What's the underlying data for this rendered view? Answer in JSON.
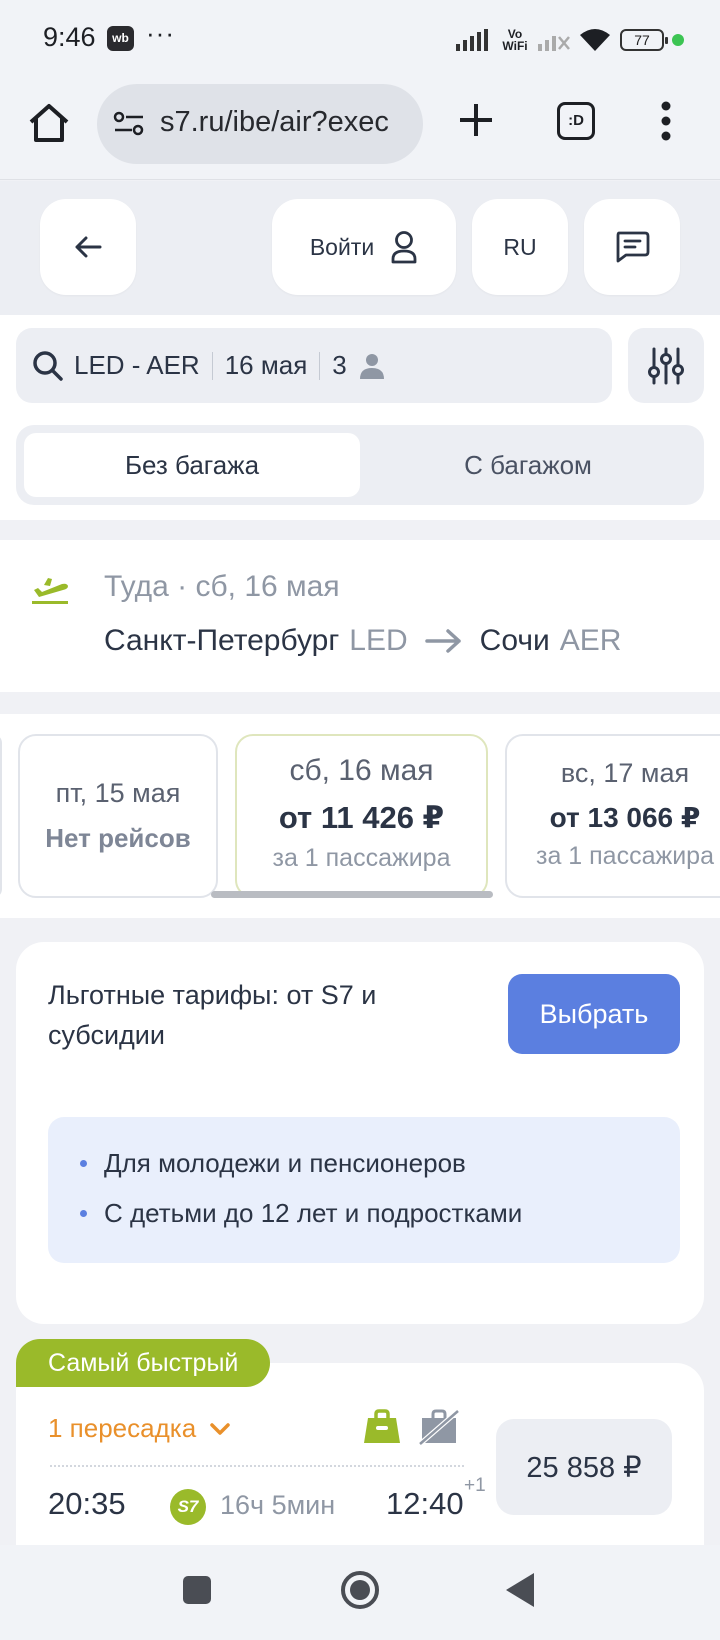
{
  "status_bar": {
    "time": "9:46",
    "app_badge": "wb",
    "more": "···",
    "network_label": "Vo WiFi",
    "battery": "77",
    "icons": [
      "signal-icon",
      "wifi-icon",
      "battery-icon"
    ]
  },
  "browser": {
    "url": "s7.ru/ibe/air?exec",
    "tabs_label": ":D",
    "icons": [
      "home-icon",
      "site-settings-icon",
      "new-tab-icon",
      "tabs-icon",
      "menu-icon"
    ]
  },
  "header": {
    "login_label": "Войти",
    "lang_label": "RU",
    "icons": [
      "back-arrow-icon",
      "user-icon",
      "chat-icon"
    ]
  },
  "search": {
    "route": "LED - AER",
    "date": "16 мая",
    "passengers": "3",
    "icons": [
      "search-icon",
      "person-icon",
      "filter-icon"
    ]
  },
  "baggage_toggle": {
    "options": [
      "Без багажа",
      "С багажом"
    ],
    "selected": "Без багажа"
  },
  "route": {
    "direction_line": "Туда · сб, 16 мая",
    "from_city": "Санкт-Петербург",
    "from_code": "LED",
    "to_city": "Сочи",
    "to_code": "AER",
    "accent_color": "#9aba2a"
  },
  "dates": [
    {
      "label": "пт, 15 мая",
      "price": "Нет рейсов",
      "sub": ""
    },
    {
      "label": "сб, 16 мая",
      "price": "от 11 426 ₽",
      "sub": "за 1 пассажира",
      "selected": true
    },
    {
      "label": "вс, 17 мая",
      "price": "от 13 066 ₽",
      "sub": "за 1 пассажира"
    }
  ],
  "promo": {
    "title": "Льготные тарифы: от S7 и субсидии",
    "button": "Выбрать",
    "items": [
      "Для молодежи и пенсионеров",
      "С детьми до 12 лет и подростками"
    ],
    "button_color": "#5b7fe0"
  },
  "flight": {
    "badge": "Самый быстрый",
    "transfers": "1 пересадка",
    "departure": "20:35",
    "airline_logo": "S7",
    "duration": "16ч 5мин",
    "arrival": "12:40",
    "day_offset": "+1",
    "price": "25 858 ₽",
    "transfer_color": "#e9902b",
    "icons": [
      "baggage-icon",
      "no-baggage-icon",
      "chevron-down-icon"
    ]
  }
}
